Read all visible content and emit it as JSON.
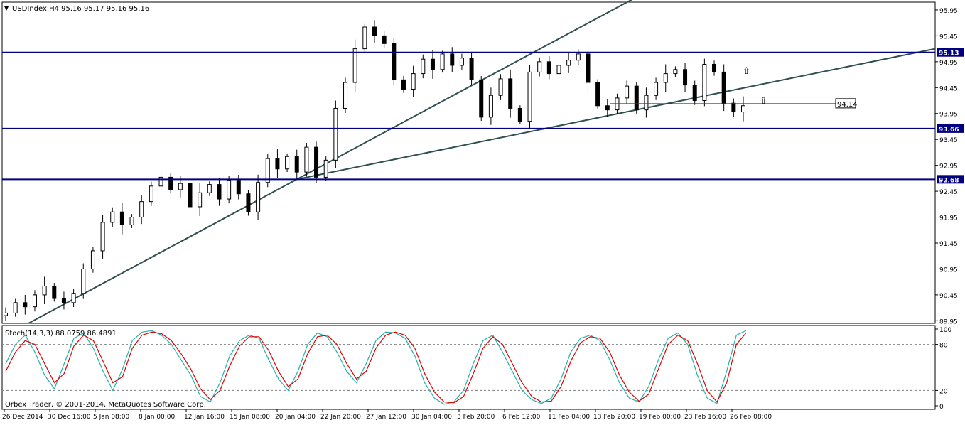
{
  "window": {
    "title": "USDIndex,H4  95.16 95.17 95.16 95.16",
    "copyright": "Orbex Trader, © 2001-2014, MetaQuotes Software Corp."
  },
  "chart_data": [
    {
      "type": "candlestick",
      "symbol": "USDIndex",
      "timeframe": "H4",
      "ohlc_header": "95.16 95.17 95.16 95.16",
      "ylim": [
        89.9,
        96.1
      ],
      "y_ticks": [
        "95.95",
        "95.45",
        "94.95",
        "94.45",
        "93.95",
        "93.45",
        "92.95",
        "92.45",
        "91.95",
        "91.45",
        "90.95",
        "90.45",
        "89.95"
      ],
      "x_ticks": [
        "26 Dec 2014",
        "30 Dec 16:00",
        "5 Jan 08:00",
        "8 Jan 00:00",
        "12 Jan 16:00",
        "15 Jan 08:00",
        "20 Jan 04:00",
        "22 Jan 20:00",
        "27 Jan 12:00",
        "30 Jan 04:00",
        "3 Feb 20:00",
        "6 Feb 12:00",
        "11 Feb 04:00",
        "13 Feb 20:00",
        "19 Feb 00:00",
        "23 Feb 16:00",
        "26 Feb 08:00"
      ],
      "horizontal_levels": [
        {
          "value": 95.13,
          "label": "95.13",
          "color": "#000080"
        },
        {
          "value": 93.66,
          "label": "93.66",
          "color": "#000080"
        },
        {
          "value": 92.68,
          "label": "92.68",
          "color": "#000080"
        }
      ],
      "support_marker": {
        "value": 94.14,
        "label": "94.14",
        "color": "#cc0000"
      },
      "close_series": [
        90.1,
        90.3,
        90.22,
        90.45,
        90.62,
        90.38,
        90.3,
        90.48,
        90.95,
        91.3,
        91.85,
        92.05,
        91.8,
        91.95,
        92.25,
        92.55,
        92.72,
        92.48,
        92.6,
        92.15,
        92.42,
        92.58,
        92.3,
        92.66,
        92.4,
        92.05,
        92.62,
        93.08,
        92.88,
        93.12,
        92.82,
        93.3,
        92.72,
        93.05,
        94.05,
        94.55,
        95.2,
        95.62,
        95.45,
        95.3,
        94.6,
        94.42,
        94.72,
        95.0,
        94.8,
        95.1,
        94.88,
        95.02,
        94.6,
        93.88,
        94.3,
        94.62,
        94.05,
        93.8,
        94.75,
        94.95,
        94.72,
        94.88,
        94.98,
        95.1,
        94.55,
        94.1,
        94.02,
        94.25,
        94.48,
        94.02,
        94.3,
        94.55,
        94.72,
        94.8,
        94.5,
        94.2,
        94.9,
        94.75,
        94.15,
        93.98,
        94.1
      ],
      "chart_data_note": "",
      "indicator": {
        "type": "line",
        "label": "Stoch(14,3,3) 88.0759 86.4891",
        "name": "Stoch(14,3,3)",
        "main_value": 88.0759,
        "signal_value": 86.4891,
        "ylim": [
          0,
          100
        ],
        "y_ticks": [
          "100",
          "80",
          "20",
          "0"
        ],
        "levels": [
          80,
          20
        ],
        "main_color": "#20b2aa",
        "signal_color": "#e00000",
        "main_series": [
          55,
          80,
          92,
          70,
          40,
          22,
          55,
          88,
          95,
          75,
          45,
          20,
          48,
          85,
          96,
          98,
          92,
          80,
          60,
          40,
          12,
          5,
          30,
          65,
          85,
          92,
          88,
          60,
          35,
          20,
          45,
          80,
          95,
          90,
          70,
          45,
          30,
          55,
          85,
          96,
          95,
          88,
          65,
          30,
          10,
          2,
          5,
          20,
          55,
          85,
          92,
          70,
          45,
          20,
          8,
          3,
          10,
          35,
          70,
          88,
          92,
          85,
          60,
          30,
          10,
          5,
          25,
          60,
          88,
          95,
          80,
          40,
          10,
          3,
          45,
          92,
          98
        ],
        "signal_series": [
          45,
          70,
          85,
          80,
          55,
          30,
          42,
          78,
          92,
          85,
          58,
          30,
          38,
          75,
          92,
          96,
          94,
          85,
          68,
          48,
          22,
          8,
          20,
          52,
          78,
          90,
          90,
          72,
          45,
          25,
          35,
          68,
          90,
          92,
          80,
          55,
          35,
          45,
          75,
          92,
          96,
          92,
          75,
          42,
          18,
          5,
          4,
          12,
          42,
          75,
          90,
          80,
          55,
          30,
          12,
          5,
          6,
          25,
          58,
          82,
          90,
          88,
          70,
          40,
          18,
          6,
          15,
          48,
          80,
          92,
          85,
          55,
          20,
          5,
          30,
          80,
          95
        ]
      }
    }
  ],
  "colors": {
    "bull_candle": "#ffffff",
    "bear_candle": "#000000",
    "candle_outline": "#000000",
    "trendline": "#2f4f4f",
    "label_bg": "#000080",
    "label_text": "#ffffff"
  }
}
